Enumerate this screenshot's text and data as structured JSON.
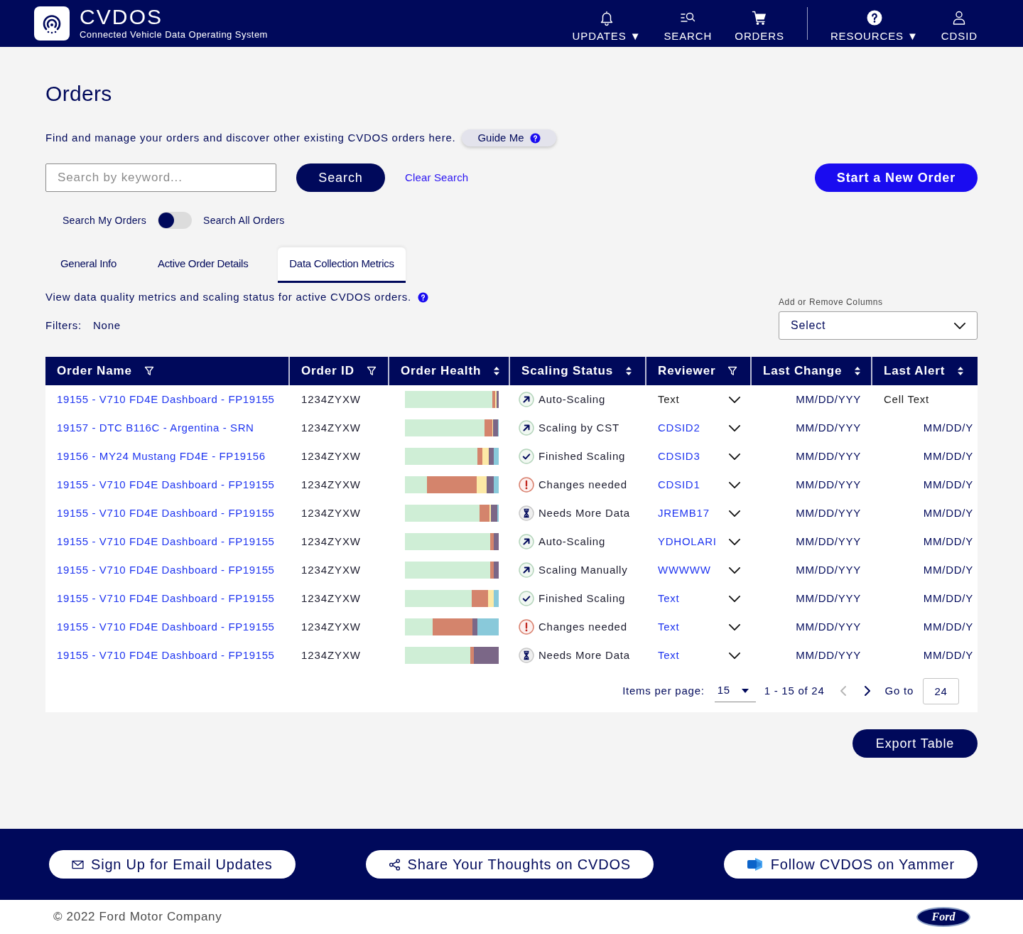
{
  "header": {
    "app_name": "CVDOS",
    "subtitle": "Connected Vehicle Data Operating System",
    "nav_main": [
      {
        "label": "UPDATES ▼"
      },
      {
        "label": "SEARCH"
      },
      {
        "label": "ORDERS"
      }
    ],
    "nav_secondary": [
      {
        "label": "RESOURCES ▼"
      },
      {
        "label": "CDSID"
      }
    ]
  },
  "page": {
    "title": "Orders",
    "intro": "Find and manage your orders and discover other existing CVDOS orders here.",
    "guide_button": "Guide Me"
  },
  "search": {
    "placeholder": "Search by keyword...",
    "button": "Search",
    "clear": "Clear Search",
    "new_order": "Start a New Order"
  },
  "scope_toggle": {
    "left_label": "Search My Orders",
    "right_label": "Search All Orders",
    "on": false
  },
  "tabs": [
    {
      "label": "General Info",
      "selected": false
    },
    {
      "label": "Active Order Details",
      "selected": false
    },
    {
      "label": "Data Collection Metrics",
      "selected": true
    }
  ],
  "tab_intro": "View data quality metrics and scaling status for active CVDOS orders.",
  "filters": {
    "label": "Filters:",
    "value": "None"
  },
  "columns_picker": {
    "label": "Add or Remove Columns",
    "value": "Select"
  },
  "table": {
    "columns": [
      {
        "label": "Order Name",
        "kind": "filter"
      },
      {
        "label": "Order ID",
        "kind": "filter"
      },
      {
        "label": "Order Health",
        "kind": "sort"
      },
      {
        "label": "Scaling Status",
        "kind": "sort"
      },
      {
        "label": "Reviewer",
        "kind": "filter"
      },
      {
        "label": "Last Change",
        "kind": "sort"
      },
      {
        "label": "Last Alert",
        "kind": "sort"
      }
    ],
    "rows": [
      {
        "order_name": "19155 - V710 FD4E Dashboard - FP19155",
        "order_id": "1234ZYXW",
        "status": {
          "kind": "scaling",
          "text": "Auto-Scaling"
        },
        "reviewer": {
          "kind": "text",
          "text": "Text"
        },
        "expanded": false,
        "last_change": "MM/DD/YYY",
        "last_alert": {
          "kind": "text",
          "text": "Cell Text"
        }
      },
      {
        "order_name": "19157 - DTC B116C - Argentina - SRN",
        "order_id": "1234ZYXW",
        "status": {
          "kind": "scaling",
          "text": "Scaling by CST"
        },
        "reviewer": {
          "kind": "link",
          "text": "CDSID2"
        },
        "expanded": false,
        "last_change": "MM/DD/YYY",
        "last_alert": {
          "kind": "date",
          "text": "MM/DD/Y"
        }
      },
      {
        "order_name": "19156 - MY24 Mustang FD4E - FP19156",
        "order_id": "1234ZYXW",
        "status": {
          "kind": "done",
          "text": "Finished Scaling"
        },
        "reviewer": {
          "kind": "link",
          "text": "CDSID3"
        },
        "expanded": false,
        "last_change": "MM/DD/YYY",
        "last_alert": {
          "kind": "date",
          "text": "MM/DD/Y"
        }
      },
      {
        "order_name": "19155 - V710 FD4E Dashboard - FP19155",
        "order_id": "1234ZYXW",
        "status": {
          "kind": "alert",
          "text": "Changes needed"
        },
        "reviewer": {
          "kind": "link",
          "text": "CDSID1"
        },
        "expanded": false,
        "last_change": "MM/DD/YYY",
        "last_alert": {
          "kind": "date",
          "text": "MM/DD/Y"
        }
      },
      {
        "order_name": "19155 - V710 FD4E Dashboard - FP19155",
        "order_id": "1234ZYXW",
        "status": {
          "kind": "waiting",
          "text": "Needs More Data"
        },
        "reviewer": {
          "kind": "link",
          "text": "JREMB17"
        },
        "expanded": false,
        "last_change": "MM/DD/YYY",
        "last_alert": {
          "kind": "date",
          "text": "MM/DD/Y"
        }
      },
      {
        "order_name": "19155 - V710 FD4E Dashboard - FP19155",
        "order_id": "1234ZYXW",
        "status": {
          "kind": "scaling",
          "text": "Auto-Scaling"
        },
        "reviewer": {
          "kind": "link",
          "text": "YDHOLARI"
        },
        "expanded": false,
        "last_change": "MM/DD/YYY",
        "last_alert": {
          "kind": "date",
          "text": "MM/DD/Y"
        }
      },
      {
        "order_name": "19155 - V710 FD4E Dashboard - FP19155",
        "order_id": "1234ZYXW",
        "status": {
          "kind": "scaling",
          "text": "Scaling Manually"
        },
        "reviewer": {
          "kind": "link",
          "text": "WWWWW"
        },
        "expanded": false,
        "last_change": "MM/DD/YYY",
        "last_alert": {
          "kind": "date",
          "text": "MM/DD/Y"
        }
      },
      {
        "order_name": "19155 - V710 FD4E Dashboard - FP19155",
        "order_id": "1234ZYXW",
        "status": {
          "kind": "done",
          "text": "Finished Scaling"
        },
        "reviewer": {
          "kind": "link",
          "text": "Text"
        },
        "expanded": false,
        "last_change": "MM/DD/YYY",
        "last_alert": {
          "kind": "date",
          "text": "MM/DD/Y"
        }
      },
      {
        "order_name": "19155 - V710 FD4E Dashboard - FP19155",
        "order_id": "1234ZYXW",
        "status": {
          "kind": "alert",
          "text": "Changes needed"
        },
        "reviewer": {
          "kind": "link",
          "text": "Text"
        },
        "expanded": false,
        "last_change": "MM/DD/YYY",
        "last_alert": {
          "kind": "date",
          "text": "MM/DD/Y"
        }
      },
      {
        "order_name": "19155 - V710 FD4E Dashboard - FP19155",
        "order_id": "1234ZYXW",
        "status": {
          "kind": "waiting",
          "text": "Needs More Data"
        },
        "reviewer": {
          "kind": "link",
          "text": "Text"
        },
        "expanded": false,
        "last_change": "MM/DD/YYY",
        "last_alert": {
          "kind": "date",
          "text": "MM/DD/Y"
        }
      }
    ]
  },
  "pagination": {
    "per_page_label": "Items per page:",
    "per_page": "15",
    "range": "1 - 15 of 24",
    "prev_disabled": true,
    "next_disabled": false,
    "goto_label": "Go to",
    "goto_value": "24"
  },
  "export_button": "Export Table",
  "footer": {
    "links": [
      {
        "label": "Sign Up for Email Updates"
      },
      {
        "label": "Share Your Thoughts on CVDOS"
      },
      {
        "label": "Follow CVDOS on Yammer"
      }
    ],
    "copyright": "© 2022 Ford Motor Company",
    "logo": "Ford"
  }
}
